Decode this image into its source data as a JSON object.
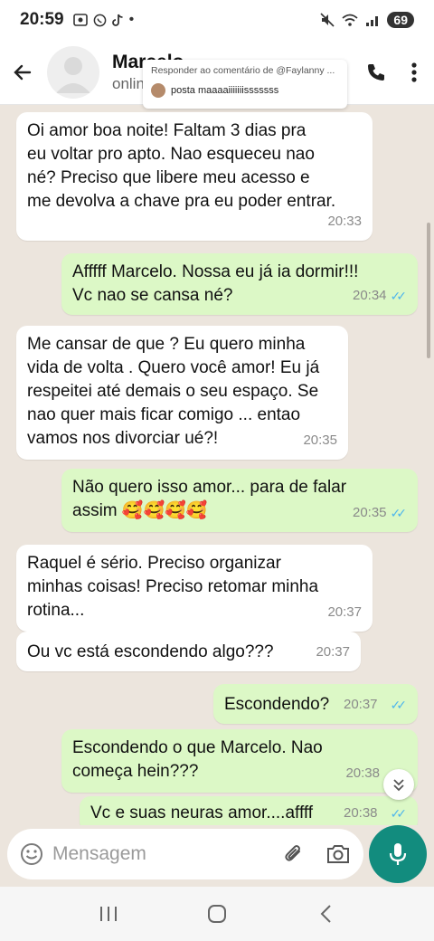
{
  "status_bar": {
    "time": "20:59",
    "battery": "69",
    "left_icons": [
      "screen-record-icon",
      "whatsapp-icon",
      "tiktok-icon",
      "dot-icon"
    ],
    "right_icons": [
      "mute-icon",
      "wifi-icon",
      "signal-icon"
    ]
  },
  "header": {
    "contact_name": "Marcelo",
    "contact_status": "online",
    "icons": [
      "back-arrow-icon",
      "avatar-placeholder-icon",
      "call-icon",
      "menu-dots-icon"
    ]
  },
  "reply_overlay": {
    "title": "Responder ao comentário de @Faylanny ...",
    "comment": "posta maaaaiiiiiiisssssss"
  },
  "messages": [
    {
      "dir": "in",
      "lines": [
        "Oi amor boa noite! Faltam 3 dias pra",
        "eu voltar pro apto. Nao esqueceu nao",
        "né? Preciso que libere meu acesso e",
        "me devolva a chave pra eu poder entrar."
      ],
      "time": "20:33"
    },
    {
      "dir": "out",
      "lines": [
        "Afffff Marcelo. Nossa eu já ia dormir!!!",
        "Vc nao se cansa né?"
      ],
      "time": "20:34",
      "read": true
    },
    {
      "dir": "in",
      "lines": [
        "Me cansar de que ? Eu quero minha",
        "vida de volta . Quero você amor! Eu já",
        "respeitei até demais o seu espaço. Se",
        "nao quer mais ficar comigo ... entao",
        "vamos nos divorciar ué?!"
      ],
      "time": "20:35"
    },
    {
      "dir": "out",
      "lines": [
        "Não quero isso amor... para de falar",
        "assim 🥰🥰🥰🥰"
      ],
      "time": "20:35",
      "read": true
    },
    {
      "dir": "in",
      "lines": [
        "Raquel é sério. Preciso organizar",
        "minhas coisas! Preciso retomar minha",
        "rotina..."
      ],
      "time": "20:37"
    },
    {
      "dir": "in",
      "lines": [
        "Ou vc está escondendo algo???"
      ],
      "time": "20:37"
    },
    {
      "dir": "out",
      "lines": [
        "Escondendo?"
      ],
      "time": "20:37",
      "read": true
    },
    {
      "dir": "out",
      "lines": [
        "Escondendo o que Marcelo. Nao",
        "começa hein???"
      ],
      "time": "20:38",
      "read": false
    },
    {
      "dir": "out",
      "lines": [
        "Vc e suas neuras amor....affff"
      ],
      "time": "20:38",
      "read": true
    }
  ],
  "input": {
    "placeholder": "Mensagem",
    "icons": [
      "emoji-icon",
      "attach-icon",
      "camera-icon",
      "mic-icon"
    ]
  },
  "nav": [
    "recents-icon",
    "home-icon",
    "back-icon"
  ],
  "colors": {
    "chat_bg": "#ece5dd",
    "incoming": "#ffffff",
    "outgoing": "#dcf8c6",
    "accent": "#128c7e",
    "read_tick": "#4fb6ec"
  }
}
